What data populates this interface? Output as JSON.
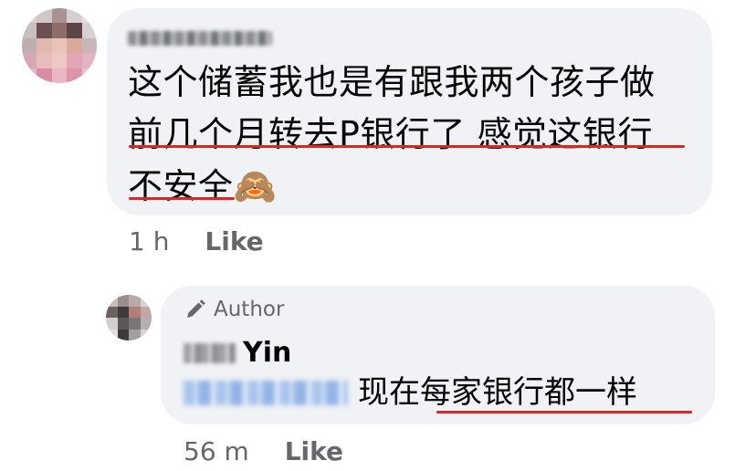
{
  "comment": {
    "lines": [
      "这个储蓄我也是有跟我两个孩子做",
      "前几个月转去P银行了 感觉这银行",
      "不安全🙈"
    ],
    "time": "1 h",
    "like": "Like"
  },
  "reply": {
    "badge_label": "Author",
    "author_visible_name": "Yin",
    "text": "现在每家银行都一样",
    "time": "56 m",
    "like": "Like"
  },
  "colors": {
    "bubble": "#f0f2f5",
    "underline": "#e02424",
    "meta": "#65676b",
    "mention": "#a9c4ec"
  },
  "icons": [
    "pen-author-icon"
  ]
}
